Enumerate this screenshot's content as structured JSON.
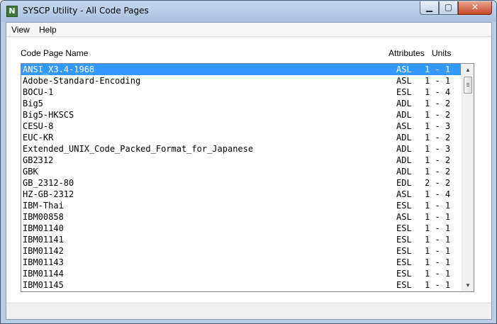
{
  "window": {
    "app_icon_glyph": "N",
    "title": "SYSCP Utility - All Code Pages",
    "minimize_glyph": "▁",
    "maximize_glyph": "▢",
    "close_glyph": "✕"
  },
  "menu": {
    "items": [
      {
        "label": "View"
      },
      {
        "label": "Help"
      }
    ]
  },
  "columns": {
    "name": "Code Page Name",
    "attributes": "Attributes",
    "units": "Units"
  },
  "code_pages": [
    {
      "name": "ANSI_X3.4-1968",
      "attributes": "ASL",
      "units": "1 - 1",
      "selected": true
    },
    {
      "name": "Adobe-Standard-Encoding",
      "attributes": "ASL",
      "units": "1 - 1"
    },
    {
      "name": "BOCU-1",
      "attributes": "ESL",
      "units": "1 - 4"
    },
    {
      "name": "Big5",
      "attributes": "ADL",
      "units": "1 - 2"
    },
    {
      "name": "Big5-HKSCS",
      "attributes": "ADL",
      "units": "1 - 2"
    },
    {
      "name": "CESU-8",
      "attributes": "ASL",
      "units": "1 - 3"
    },
    {
      "name": "EUC-KR",
      "attributes": "ADL",
      "units": "1 - 2"
    },
    {
      "name": "Extended_UNIX_Code_Packed_Format_for_Japanese",
      "attributes": "ADL",
      "units": "1 - 3"
    },
    {
      "name": "GB2312",
      "attributes": "ADL",
      "units": "1 - 2"
    },
    {
      "name": "GBK",
      "attributes": "ADL",
      "units": "1 - 2"
    },
    {
      "name": "GB_2312-80",
      "attributes": "EDL",
      "units": "2 - 2"
    },
    {
      "name": "HZ-GB-2312",
      "attributes": "ASL",
      "units": "1 - 4"
    },
    {
      "name": "IBM-Thai",
      "attributes": "ESL",
      "units": "1 - 1"
    },
    {
      "name": "IBM00858",
      "attributes": "ASL",
      "units": "1 - 1"
    },
    {
      "name": "IBM01140",
      "attributes": "ESL",
      "units": "1 - 1"
    },
    {
      "name": "IBM01141",
      "attributes": "ESL",
      "units": "1 - 1"
    },
    {
      "name": "IBM01142",
      "attributes": "ESL",
      "units": "1 - 1"
    },
    {
      "name": "IBM01143",
      "attributes": "ESL",
      "units": "1 - 1"
    },
    {
      "name": "IBM01144",
      "attributes": "ESL",
      "units": "1 - 1"
    },
    {
      "name": "IBM01145",
      "attributes": "ESL",
      "units": "1 - 1"
    }
  ],
  "scrollbar": {
    "up_glyph": "▲",
    "down_glyph": "▼"
  },
  "status": {
    "text": ""
  },
  "colors": {
    "selection": "#3399ff",
    "title_bar": "#b9cde5",
    "close_button": "#c7452a"
  }
}
